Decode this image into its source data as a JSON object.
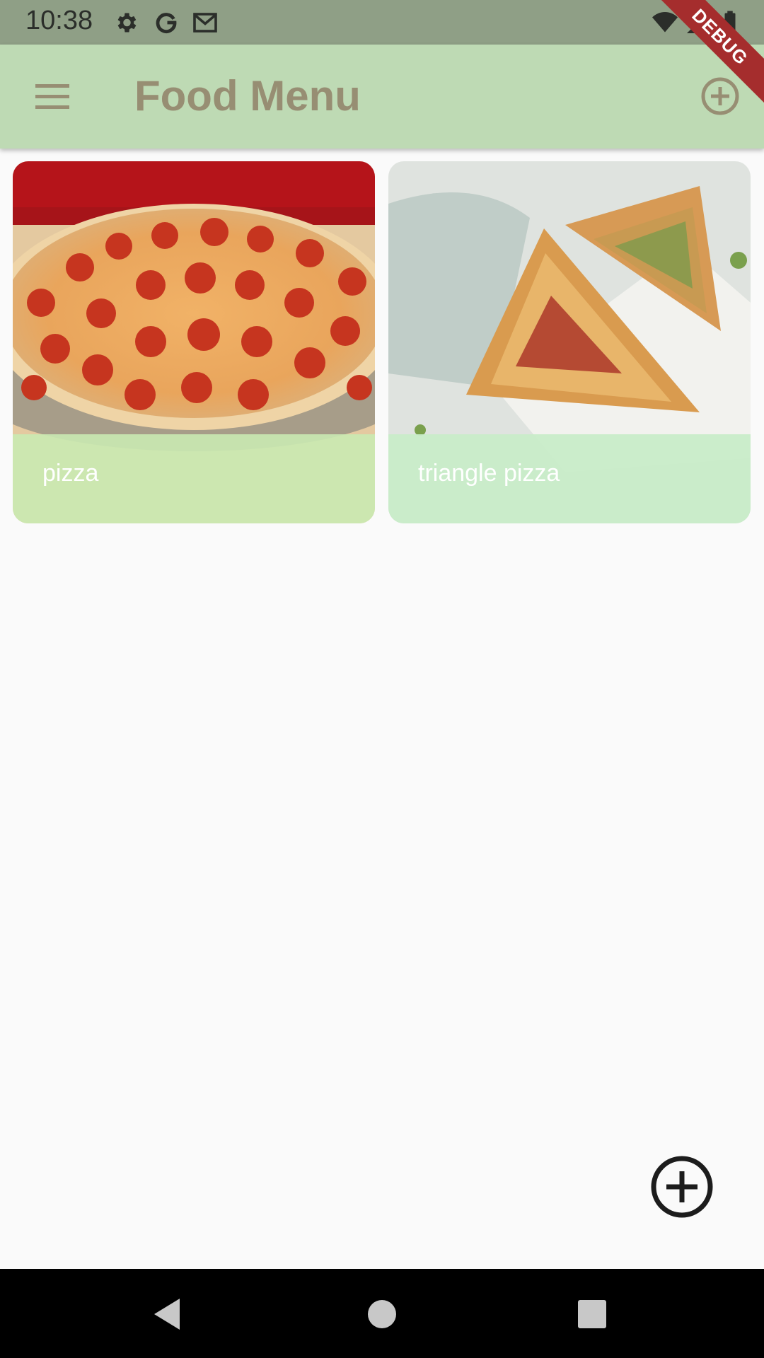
{
  "status_bar": {
    "time": "10:38",
    "icons": [
      "gear-icon",
      "google-icon",
      "gmail-icon",
      "wifi-icon",
      "signal-icon",
      "battery-icon"
    ]
  },
  "app_bar": {
    "title": "Food Menu",
    "menu_icon": "hamburger-icon",
    "action_icon": "add-circle-icon"
  },
  "debug_banner": {
    "label": "DEBUG"
  },
  "grid": {
    "items": [
      {
        "label": "pizza",
        "image": "pepperoni-pizza-photo"
      },
      {
        "label": "triangle pizza",
        "image": "triangle-pizza-photo"
      }
    ]
  },
  "fab": {
    "icon": "add-circle-icon"
  },
  "nav_bar": {
    "buttons": [
      "back-icon",
      "home-icon",
      "recents-icon"
    ]
  },
  "colors": {
    "status_bar": "#8f9f86",
    "app_bar": "#bedab4",
    "title": "#978e73",
    "background": "#fafafa",
    "caption_overlay": "#c8eab4"
  }
}
